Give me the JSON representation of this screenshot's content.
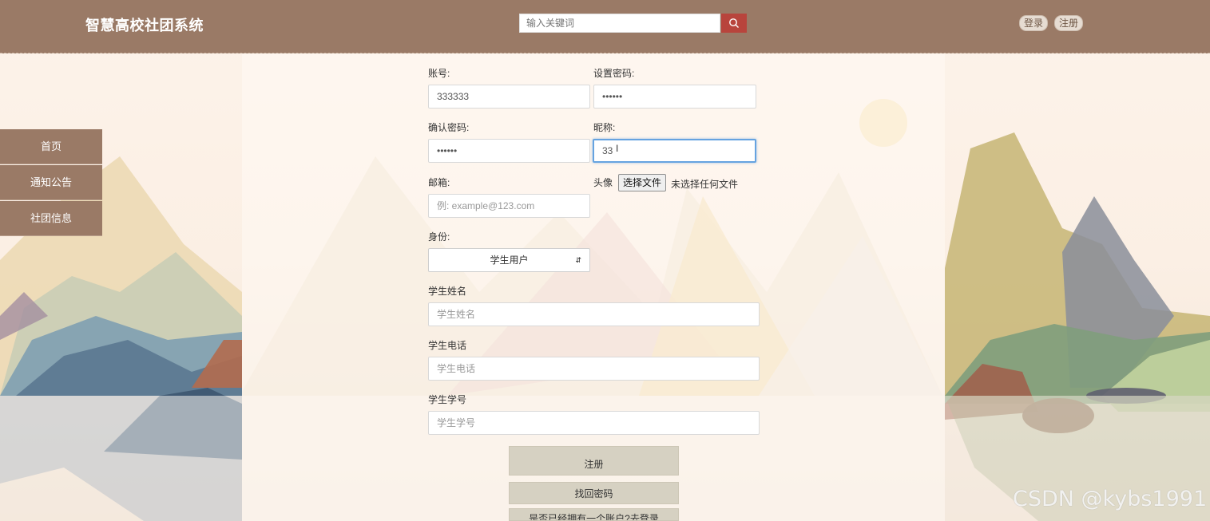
{
  "header": {
    "title": "智慧高校社团系统",
    "search_placeholder": "输入关键词",
    "login_label": "登录",
    "register_label": "注册"
  },
  "sidebar": {
    "items": [
      {
        "label": "首页"
      },
      {
        "label": "通知公告"
      },
      {
        "label": "社团信息"
      }
    ]
  },
  "form": {
    "account_label": "账号:",
    "account_value": "333333",
    "password_label": "设置密码:",
    "password_value": "••••••",
    "confirm_label": "确认密码:",
    "confirm_value": "••••••",
    "nickname_label": "昵称:",
    "nickname_value": "33",
    "email_label": "邮箱:",
    "email_placeholder": "例: example@123.com",
    "avatar_label": "头像",
    "file_button_label": "选择文件",
    "file_none_text": "未选择任何文件",
    "role_label": "身份:",
    "role_selected": "学生用户",
    "student_name_label": "学生姓名",
    "student_name_placeholder": "学生姓名",
    "student_phone_label": "学生电话",
    "student_phone_placeholder": "学生电话",
    "student_no_label": "学生学号",
    "student_no_placeholder": "学生学号",
    "register_button": "注册",
    "forgot_button": "找回密码",
    "has_account_button": "是否已经拥有一个账户?去登录"
  },
  "watermark": "CSDN @kybs1991",
  "colors": {
    "header_bg": "#9a7a66",
    "search_button": "#b8443c",
    "nav_bg": "#9a7a66",
    "action_button": "#d6d1c2",
    "focus_border": "#66a3e0"
  }
}
